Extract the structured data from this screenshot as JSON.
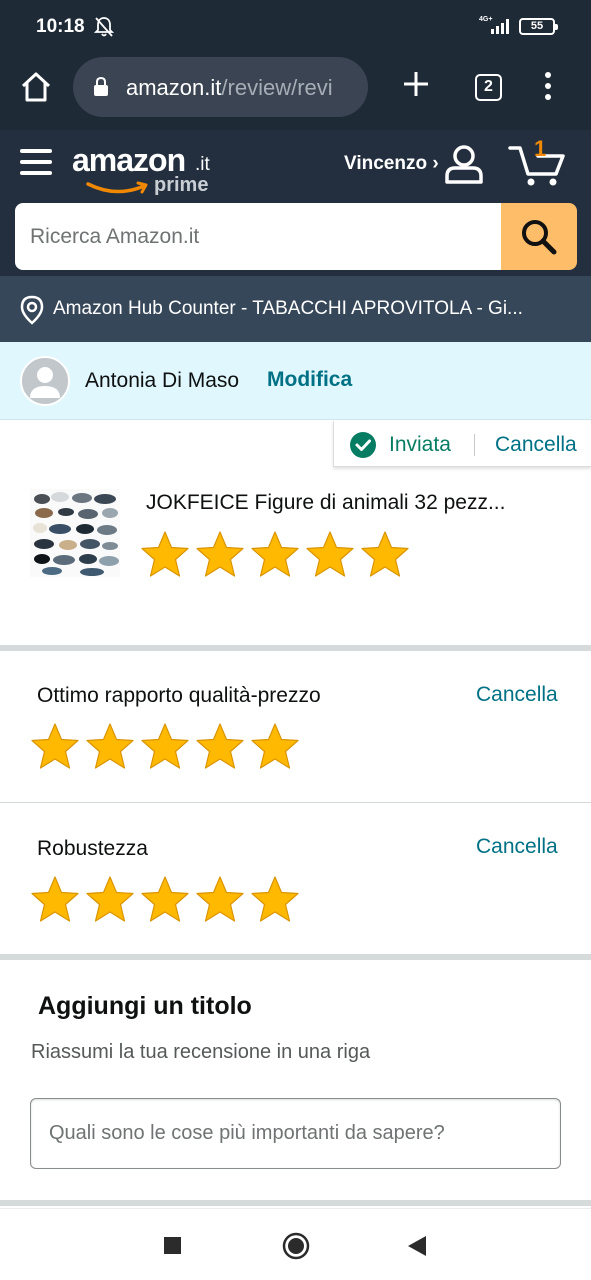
{
  "status_bar": {
    "time": "10:18",
    "network": "4G+",
    "battery": "55",
    "icons": [
      "bell-off-icon",
      "signal-icon",
      "battery-icon"
    ]
  },
  "browser": {
    "url_host": "amazon.it",
    "url_path": "/review/revi",
    "tab_count": "2",
    "icons": [
      "home-icon",
      "lock-icon",
      "plus-icon",
      "tabs-icon",
      "more-vert-icon"
    ]
  },
  "amazon_header": {
    "logo_word": "amazon",
    "logo_tld": ".it",
    "logo_prime": "prime",
    "user_greeting": "Vincenzo ›",
    "cart_count": "1",
    "search": {
      "placeholder": "Ricerca Amazon.it",
      "value": ""
    },
    "location": "Amazon Hub Counter - TABACCHI APROVITOLA - Gi..."
  },
  "profile": {
    "name": "Antonia Di Maso",
    "edit_label": "Modifica"
  },
  "review_status": {
    "label": "Inviata",
    "cancel_label": "Cancella"
  },
  "product": {
    "title": "JOKFEICE Figure di animali 32 pezz...",
    "rating": 5,
    "rating_max": 5
  },
  "attributes": [
    {
      "label": "Ottimo rapporto qualità-prezzo",
      "cancel_label": "Cancella",
      "rating": 5
    },
    {
      "label": "Robustezza",
      "cancel_label": "Cancella",
      "rating": 5
    }
  ],
  "title_section": {
    "heading": "Aggiungi un titolo",
    "subtitle": "Riassumi la tua recensione in una riga",
    "placeholder": "Quali sono le cose più importanti da sapere?",
    "value": ""
  },
  "colors": {
    "header_bg": "#232f3e",
    "link": "#007185",
    "success": "#067d62",
    "star": "#ffb900",
    "search_btn": "#febd69"
  }
}
